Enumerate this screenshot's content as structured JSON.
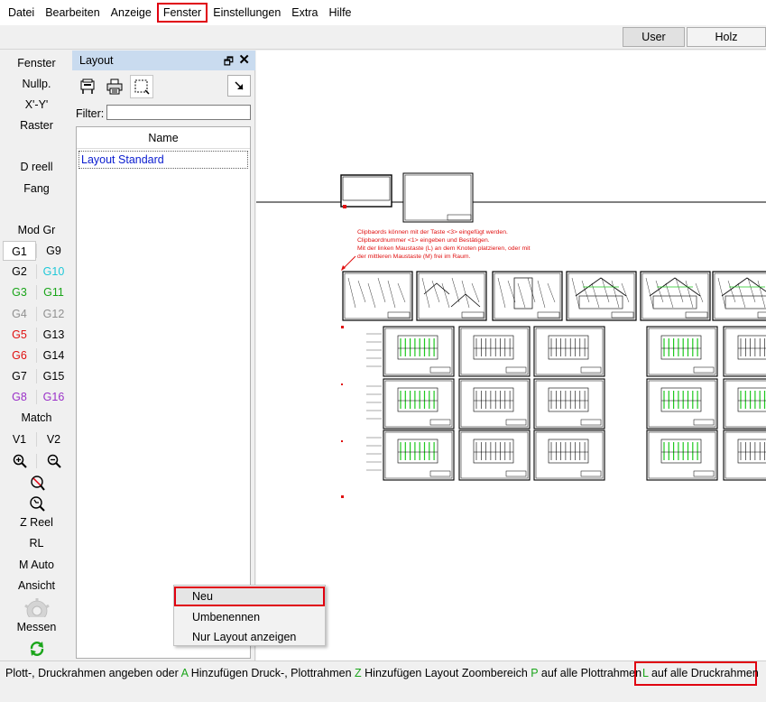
{
  "menu": {
    "items": [
      "Datei",
      "Bearbeiten",
      "Anzeige",
      "Fenster",
      "Einstellungen",
      "Extra",
      "Hilfe"
    ],
    "highlighted": "Fenster"
  },
  "tabs": {
    "user": "User",
    "holz": "Holz",
    "active": "Holz"
  },
  "toolbar": {
    "fenster": "Fenster",
    "nullp": "Nullp.",
    "xy": "X'-Y'",
    "raster": "Raster",
    "dreell": "D reell",
    "fang": "Fang",
    "modgr": "Mod Gr",
    "groups": [
      [
        "G1",
        "G9"
      ],
      [
        "G2",
        "G10"
      ],
      [
        "G3",
        "G11"
      ],
      [
        "G4",
        "G12"
      ],
      [
        "G5",
        "G13"
      ],
      [
        "G6",
        "G14"
      ],
      [
        "G7",
        "G15"
      ],
      [
        "G8",
        "G16"
      ]
    ],
    "group_colors": {
      "G1": "#000000",
      "G9": "#000000",
      "G2": "#000000",
      "G10": "#1ec8d8",
      "G3": "#1aa51a",
      "G11": "#1aa51a",
      "G4": "#909090",
      "G12": "#909090",
      "G5": "#e01010",
      "G13": "#000000",
      "G6": "#e01010",
      "G14": "#000000",
      "G7": "#000000",
      "G15": "#000000",
      "G8": "#9a30c8",
      "G16": "#9a30c8"
    },
    "match": "Match",
    "v1": "V1",
    "v2": "V2",
    "icons": [
      "zoom-in-icon",
      "zoom-out-icon",
      "zoom-window-icon",
      "zoom-refresh-icon",
      "gear-icon",
      "refresh-icon"
    ],
    "zreel": "Z Reel",
    "rl": "RL",
    "mauto": "M Auto",
    "ansicht": "Ansicht",
    "messen": "Messen"
  },
  "panel": {
    "title": "Layout",
    "float_icon": "float-icon",
    "close_icon": "close-icon",
    "filter_label": "Filter:",
    "filter_value": "",
    "column_header": "Name",
    "rows": [
      "Layout Standard"
    ]
  },
  "context_menu": {
    "items": [
      "Neu",
      "Umbenennen",
      "Nur Layout anzeigen"
    ],
    "highlighted": "Neu"
  },
  "drawing": {
    "hint_lines": [
      "Clipbaords können mit der Taste <3> eingefügt werden.",
      "Clipbaordnummer <1> eingeben und Bestätigen.",
      "Mit der linken Maustaste (L) an dem Knoten platzieren, oder mit",
      "der mittleren Maustaste (M) frei im Raum."
    ],
    "hint_color": "#e01010",
    "accent_green": "#1ec81e"
  },
  "status": {
    "t1": "Plott-, Druckrahmen angeben    oder ",
    "k1": "A",
    "t2": " Hinzufügen Druck-, Plottrahmen ",
    "k2": "Z",
    "t3": " Hinzufügen Layout Zoombereich ",
    "k3": "P",
    "t4": " auf alle Plottrahmen",
    "k4": "L",
    "t5": " auf alle Druckrahmen"
  }
}
